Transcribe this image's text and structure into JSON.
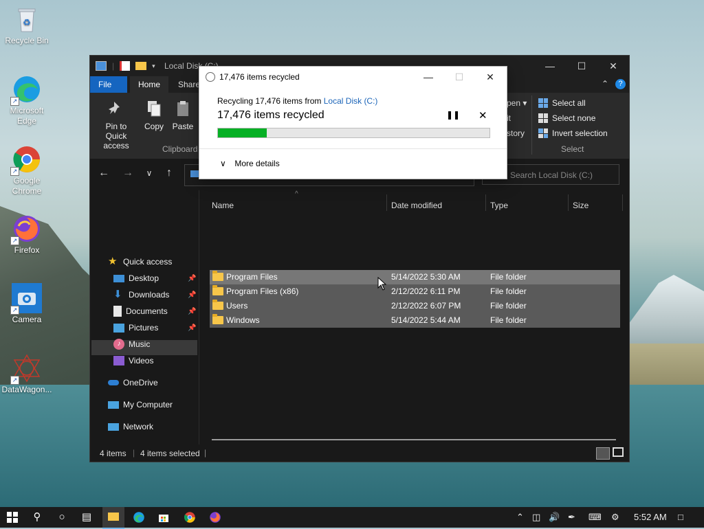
{
  "desktop": {
    "icons": [
      {
        "label": "Recycle Bin"
      },
      {
        "label": "Microsoft Edge"
      },
      {
        "label": "Google Chrome"
      },
      {
        "label": "Firefox"
      },
      {
        "label": "Camera"
      },
      {
        "label": "DataWagon..."
      }
    ]
  },
  "explorer": {
    "title": "Local Disk (C:)",
    "tabs": [
      "File",
      "Home",
      "Share"
    ],
    "ribbon": {
      "pin_label": "Pin to Quick access",
      "copy_label": "Copy",
      "paste_label": "Paste",
      "clipboard_group": "Clipboard",
      "open_fragment": "pen",
      "edit_fragment": "it",
      "history_fragment": "story",
      "select_all": "Select all",
      "select_none": "Select none",
      "invert_selection": "Invert selection",
      "select_group": "Select"
    },
    "search_placeholder": "Search Local Disk (C:)",
    "nav": {
      "quick_access": "Quick access",
      "desktop": "Desktop",
      "downloads": "Downloads",
      "documents": "Documents",
      "pictures": "Pictures",
      "music": "Music",
      "videos": "Videos",
      "onedrive": "OneDrive",
      "my_computer": "My Computer",
      "network": "Network"
    },
    "columns": {
      "name": "Name",
      "date": "Date modified",
      "type": "Type",
      "size": "Size"
    },
    "rows": [
      {
        "name": "Program Files",
        "date": "5/14/2022 5:30 AM",
        "type": "File folder"
      },
      {
        "name": "Program Files (x86)",
        "date": "2/12/2022 6:11 PM",
        "type": "File folder"
      },
      {
        "name": "Users",
        "date": "2/12/2022 6:07 PM",
        "type": "File folder"
      },
      {
        "name": "Windows",
        "date": "5/14/2022 5:44 AM",
        "type": "File folder"
      }
    ],
    "status": {
      "items": "4 items",
      "selected": "4 items selected"
    }
  },
  "dialog": {
    "title": "17,476 items recycled",
    "line_prefix": "Recycling 17,476 items from",
    "source_link": "Local Disk (C:)",
    "headline": "17,476 items recycled",
    "progress": 0.18,
    "more_details": "More details"
  },
  "taskbar": {
    "clock": "5:52 AM"
  },
  "colors": {
    "accent": "#1565c0",
    "progress_green": "#06b025",
    "link": "#1a64b8"
  }
}
